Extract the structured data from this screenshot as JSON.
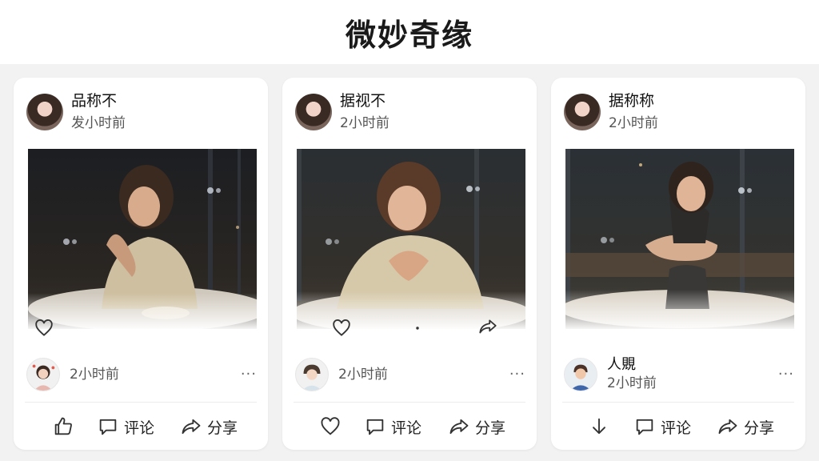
{
  "page": {
    "title": "微妙奇缘"
  },
  "posts": [
    {
      "author": "品称不",
      "time": "发小时前",
      "comment": {
        "name": "",
        "time": "2小时前",
        "more": "···"
      },
      "actions": {
        "comment": "评论",
        "share": "分享"
      }
    },
    {
      "author": "据视不",
      "time": "2小时前",
      "comment": {
        "name": "",
        "time": "2小时前",
        "more": "···"
      },
      "actions": {
        "comment": "评论",
        "share": "分享"
      }
    },
    {
      "author": "据称称",
      "time": "2小时前",
      "comment": {
        "name": "人覞",
        "time": "2小时前",
        "more": "···"
      },
      "actions": {
        "comment": "评论",
        "share": "分享"
      }
    }
  ],
  "colors": {
    "background": "#f2f2f2",
    "card": "#ffffff",
    "icon": "#333333",
    "muted": "#555555"
  }
}
